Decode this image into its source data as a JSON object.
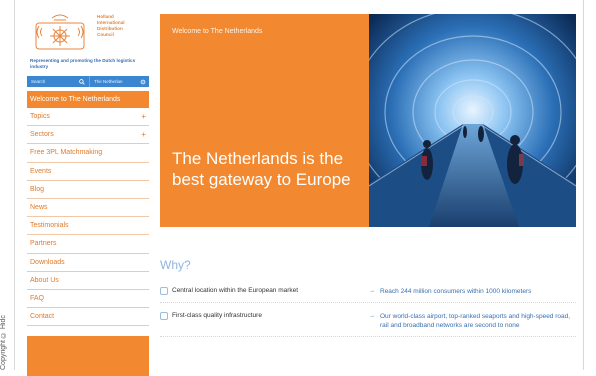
{
  "copyright": "Copyright © Hidc",
  "logo": {
    "org_name": [
      "Holland",
      "International",
      "Distribution",
      "Council"
    ],
    "tagline": "Representing and promoting the Dutch logistics industry"
  },
  "search": {
    "placeholder": "Search",
    "language": "The Netherlan"
  },
  "nav": {
    "items": [
      {
        "label": "Welcome to The Netherlands",
        "plus": ""
      },
      {
        "label": "Topics",
        "plus": "+"
      },
      {
        "label": "Sectors",
        "plus": "+"
      },
      {
        "label": "Free 3PL Matchmaking",
        "plus": ""
      },
      {
        "label": "Events",
        "plus": ""
      },
      {
        "label": "Blog",
        "plus": ""
      },
      {
        "label": "News",
        "plus": ""
      },
      {
        "label": "Testimonials",
        "plus": ""
      },
      {
        "label": "Partners",
        "plus": ""
      },
      {
        "label": "Downloads",
        "plus": ""
      },
      {
        "label": "About Us",
        "plus": ""
      },
      {
        "label": "FAQ",
        "plus": ""
      },
      {
        "label": "Contact",
        "plus": ""
      }
    ]
  },
  "hero": {
    "small_title": "Welcome to The Netherlands",
    "headline": "The Netherlands is the best gateway to Europe"
  },
  "why": {
    "title": "Why?",
    "rows": [
      {
        "left": "Central location within the European market",
        "right": "Reach 244 million consumers within 1000 kilometers"
      },
      {
        "left": "First-class quality infrastructure",
        "right": "Our world-class airport, top-ranked seaports and high-speed road, rail and broadband networks are second to none"
      }
    ]
  },
  "colors": {
    "brand_orange": "#f2882f",
    "link_blue": "#3a6fb0",
    "search_blue": "#3b86d0"
  }
}
